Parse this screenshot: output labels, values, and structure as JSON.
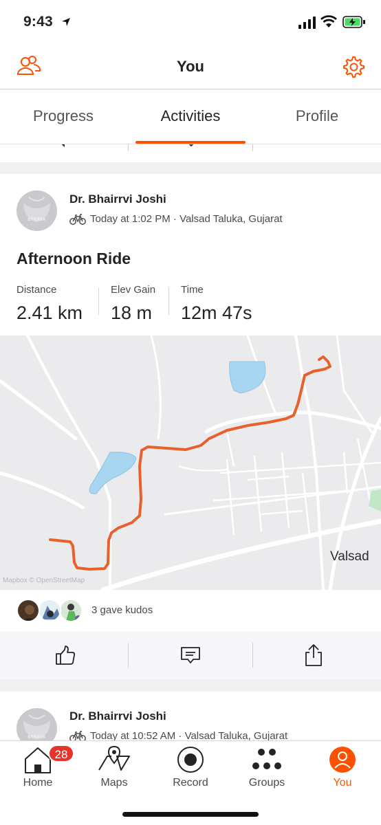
{
  "status_bar": {
    "time": "9:43"
  },
  "header": {
    "title": "You"
  },
  "tabs": [
    {
      "label": "Progress"
    },
    {
      "label": "Activities"
    },
    {
      "label": "Profile"
    }
  ],
  "activity": {
    "avatar_text": "STRAVA",
    "athlete": "Dr. Bhairrvi Joshi",
    "meta": "Today at 1:02 PM · Valsad Taluka, Gujarat",
    "title": "Afternoon Ride",
    "stats": [
      {
        "label": "Distance",
        "value": "2.41 km"
      },
      {
        "label": "Elev Gain",
        "value": "18 m"
      },
      {
        "label": "Time",
        "value": "12m 47s"
      }
    ],
    "map": {
      "place_label": "Valsad",
      "attribution": "Mapbox © OpenStreetMap",
      "route_color": "#e8602c"
    },
    "kudos_text": "3 gave kudos"
  },
  "next_activity": {
    "avatar_text": "STRAVA",
    "athlete": "Dr. Bhairrvi Joshi",
    "meta": "Today at 10:52 AM · Valsad Taluka, Gujarat"
  },
  "tabbar": {
    "items": [
      {
        "label": "Home",
        "icon": "home-icon"
      },
      {
        "label": "Maps",
        "icon": "map-icon"
      },
      {
        "label": "Record",
        "icon": "record-icon"
      },
      {
        "label": "Groups",
        "icon": "groups-icon"
      },
      {
        "label": "You",
        "icon": "profile-icon"
      }
    ],
    "home_badge": "28"
  },
  "colors": {
    "accent": "#fc5200",
    "badge": "#e8332a"
  }
}
